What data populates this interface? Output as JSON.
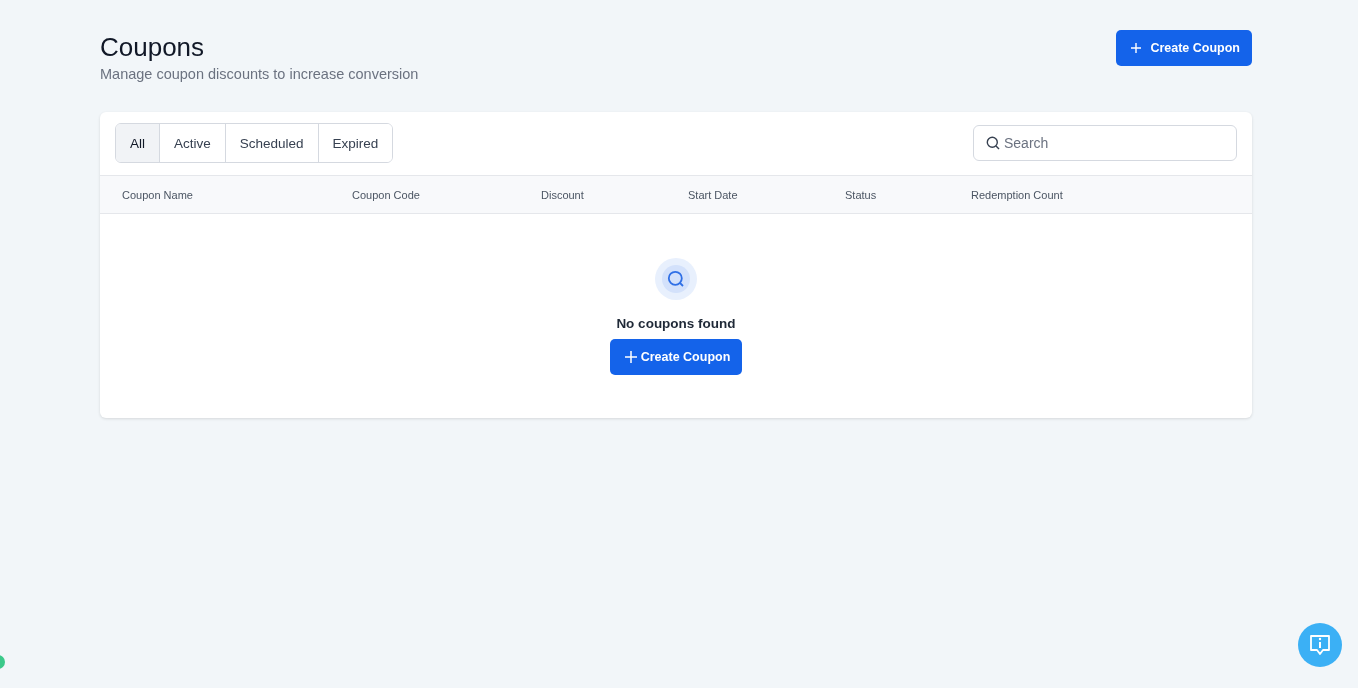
{
  "header": {
    "title": "Coupons",
    "subtitle": "Manage coupon discounts to increase conversion",
    "create_button": "Create Coupon"
  },
  "tabs": [
    {
      "label": "All",
      "selected": true
    },
    {
      "label": "Active",
      "selected": false
    },
    {
      "label": "Scheduled",
      "selected": false
    },
    {
      "label": "Expired",
      "selected": false
    }
  ],
  "search": {
    "placeholder": "Search"
  },
  "table": {
    "columns": [
      "Coupon Name",
      "Coupon Code",
      "Discount",
      "Start Date",
      "Status",
      "Redemption Count"
    ]
  },
  "empty_state": {
    "message": "No coupons found",
    "button": "Create Coupon"
  }
}
